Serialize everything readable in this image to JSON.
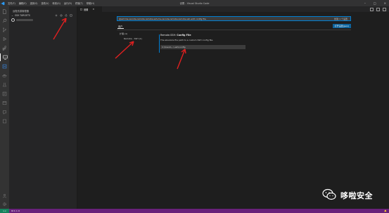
{
  "titlebar": {
    "menu": [
      "文件(F)",
      "编辑(E)",
      "选择(S)",
      "查看(V)",
      "转到(G)",
      "运行(R)",
      "终端(T)",
      "帮助(H)"
    ],
    "title": "设置 - Visual Studio Code"
  },
  "sidebar": {
    "title": "远程资源管理器",
    "section": "SSH TARGETS"
  },
  "editor": {
    "tab_label": "设置",
    "search_value": "@ext:ms-vscode-remote.remote-ssh,ms-vscode-remote.remote-ssh-edit config file",
    "found_text": "找到 1 个设置",
    "scope_tab": "用户",
    "open_json_label": "打开设置(json)",
    "toc_group": "扩展 (1)",
    "toc_item": "Remote - SSH (1)",
    "setting_title_prefix": "Remote.SSH:",
    "setting_title_name": "Config File",
    "setting_desc": "The absolute file path to a custom SSH config file.",
    "setting_value": "C:\\Users\\...\\.ssh\\config"
  },
  "statusbar": {
    "remote": "><",
    "problems": "⊗ 0  ⚠ 0"
  },
  "watermark": {
    "text": "哆啦安全"
  },
  "colors": {
    "accent": "#007fd4",
    "statusbar": "#68217a",
    "remote": "#16825d",
    "arrow": "#e02020"
  }
}
